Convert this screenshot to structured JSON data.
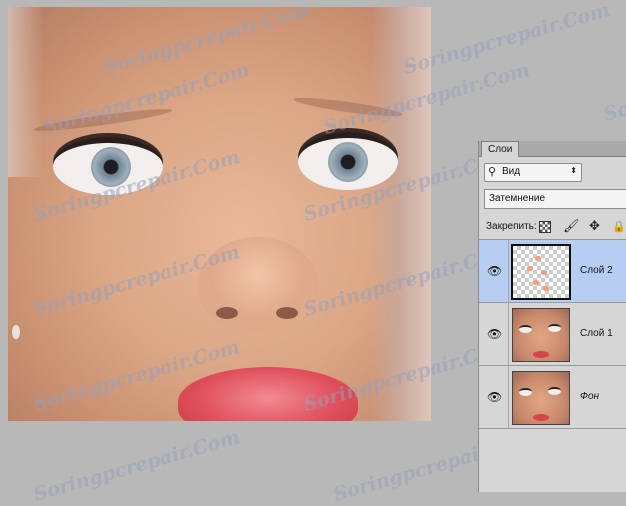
{
  "canvas": {
    "watermark": "Soringpcrepair.Com"
  },
  "layers_panel": {
    "tab_label": "Слои",
    "filter_label": "Вид",
    "blend_mode": "Затемнение",
    "lock_label": "Закрепить:",
    "layers": [
      {
        "name": "Слой 2",
        "selected": true,
        "visible": true
      },
      {
        "name": "Слой 1",
        "selected": false,
        "visible": true
      },
      {
        "name": "Фон",
        "selected": false,
        "visible": true
      }
    ]
  }
}
